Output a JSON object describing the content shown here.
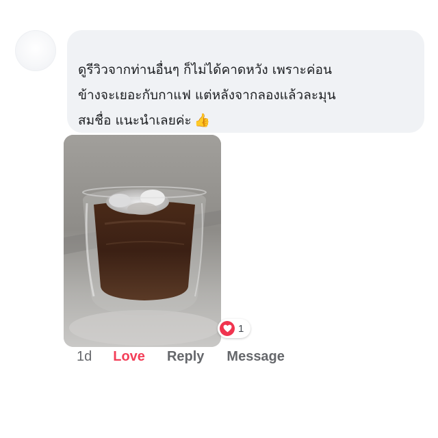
{
  "comment": {
    "author": "",
    "lines": [
      "ดูรีวิวจากท่านอื่นๆ ก็ไม่ได้คาดหวัง เพราะค่อน",
      "ข้างจะเยอะกับกาแฟ แต่หลังจากลองแล้วละมุน",
      "สมชื่อ แนะนำเลยค่ะ"
    ],
    "emoji": "👍"
  },
  "photo": {
    "alt": "iced coffee in double-wall glass"
  },
  "reactions": {
    "icon": "heart-icon",
    "count": "1",
    "color": "#f0344f"
  },
  "actions": {
    "time": "1d",
    "love": "Love",
    "reply": "Reply",
    "message": "Message"
  },
  "colors": {
    "love": "#f33e58",
    "muted": "#65676b",
    "bubble": "#f0f2f5"
  }
}
